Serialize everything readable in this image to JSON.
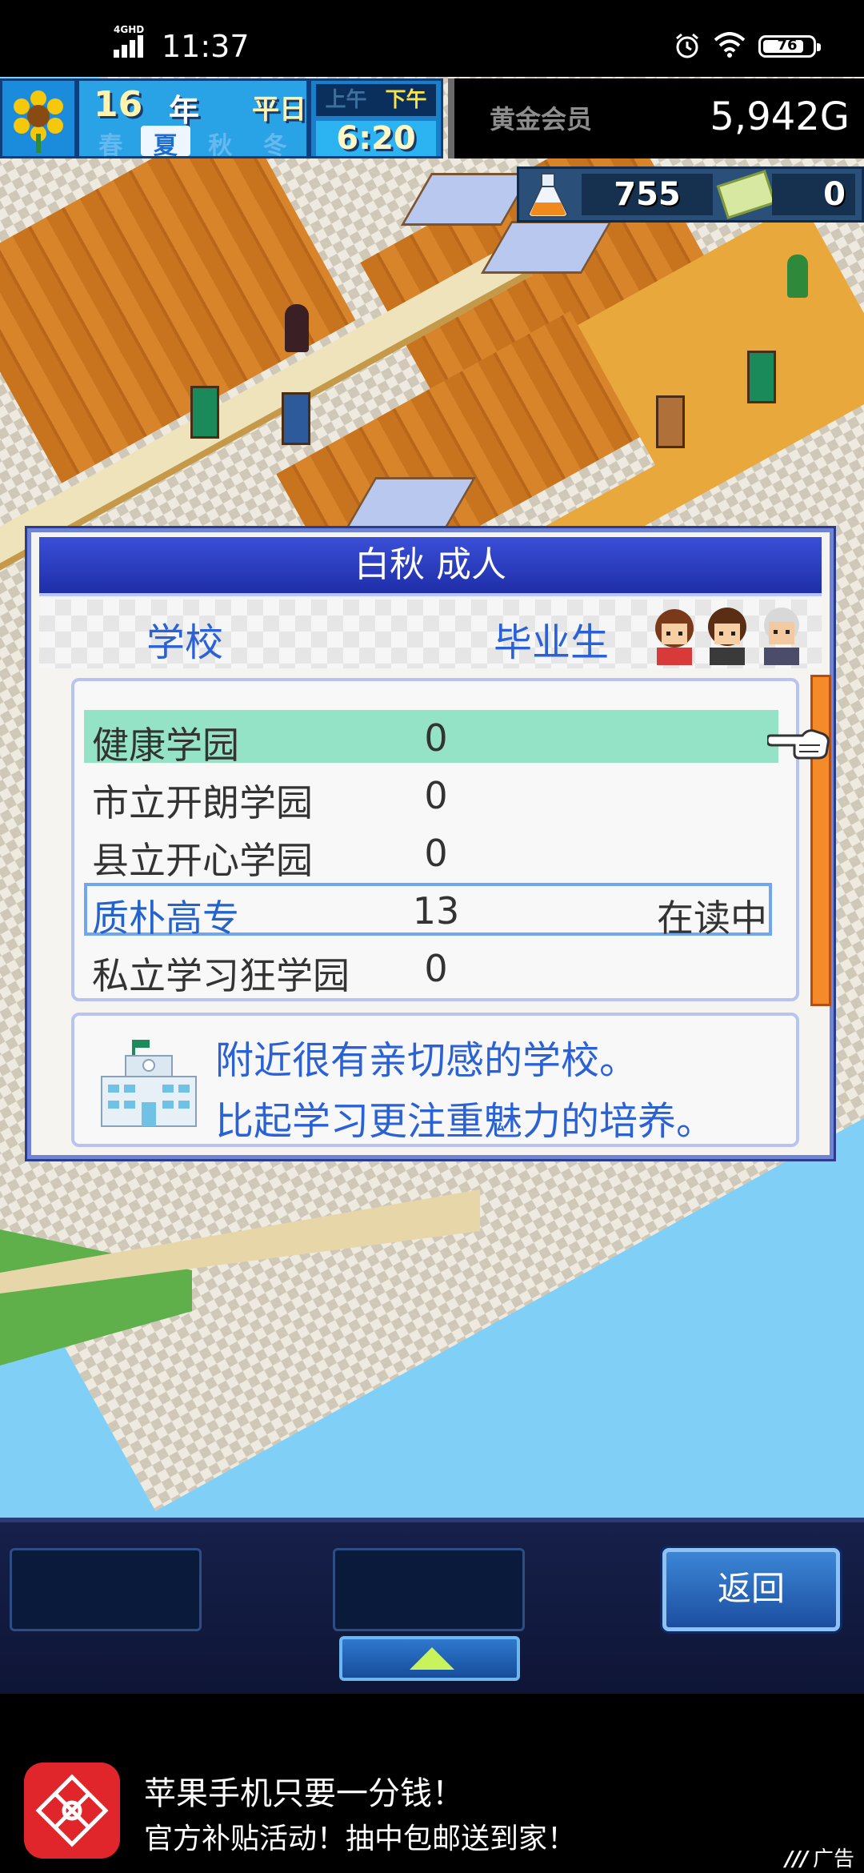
{
  "status_bar": {
    "network": "4GHD",
    "time": "11:37",
    "battery": "76"
  },
  "hud": {
    "year": "16",
    "year_unit": "年",
    "weather": "平日",
    "seasons": [
      "春",
      "夏",
      "秋",
      "冬"
    ],
    "active_season": "夏",
    "am": "上午",
    "pm": "下午",
    "active_period": "下午",
    "time": "6:20",
    "member": "黄金会员",
    "gold": "5,942G",
    "research": "755",
    "tickets": "0"
  },
  "dialog": {
    "title": "白秋 成人",
    "col_school": "学校",
    "col_graduates": "毕业生",
    "schools": [
      {
        "name": "健康学园",
        "graduates": "0",
        "status": ""
      },
      {
        "name": "市立开朗学园",
        "graduates": "0",
        "status": ""
      },
      {
        "name": "县立开心学园",
        "graduates": "0",
        "status": ""
      },
      {
        "name": "质朴高专",
        "graduates": "13",
        "status": "在读中"
      },
      {
        "name": "私立学习狂学园",
        "graduates": "0",
        "status": ""
      }
    ],
    "description_line1": "附近很有亲切感的学校。",
    "description_line2": "比起学习更注重魅力的培养。"
  },
  "controls": {
    "back_label": "返回"
  },
  "ad": {
    "line1": "苹果手机只要一分钱！",
    "line2": "官方补贴活动！抽中包邮送到家！",
    "tag": "广告"
  },
  "colors": {
    "dialog_title_bg": "#2436c0",
    "accent_blue_text": "#2a62d6",
    "selected_row": "#94e3c6",
    "scrollbar": "#f58a2a",
    "sea": "#80cff6"
  }
}
